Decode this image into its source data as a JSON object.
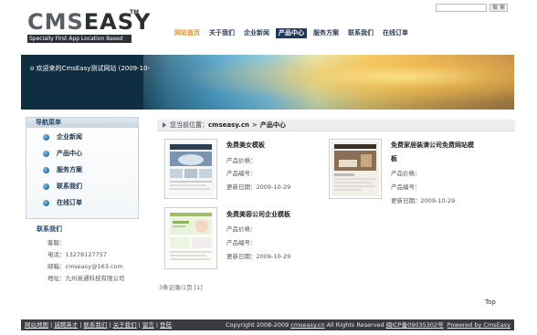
{
  "header": {
    "logo_main": "CMSEASY",
    "logo_tm": "TM",
    "logo_tag": "Specially First App Location Based",
    "search_button": "搜 索"
  },
  "nav": {
    "items": [
      "网站首页",
      "关于我们",
      "企业新闻",
      "产品中心",
      "服务方案",
      "联系我们",
      "在线订单"
    ],
    "active_index": 3
  },
  "banner": {
    "welcome": "o 欢迎来的CmsEasy测试网站 (2009-10-"
  },
  "sidebar": {
    "title": "导航菜单",
    "items": [
      "企业新闻",
      "产品中心",
      "服务方案",
      "联系我们",
      "在线订单"
    ],
    "contact_title": "联系我们",
    "contact_lines": [
      "客服：",
      "电话：13278127757",
      "邮箱：cmseasy@163.com",
      "地址：九州易通科技有限公司"
    ]
  },
  "breadcrumb": {
    "prefix": "您当前位置：",
    "site": "cmseasy.cn",
    "sep": ">",
    "current": "产品中心"
  },
  "products": [
    {
      "title": "免费美女模板",
      "price": "产品价格：",
      "code": "产品编号：",
      "date": "更新日期：2009-10-29"
    },
    {
      "title": "免费家居装潢公司免费网站模",
      "title2": "板",
      "price": "产品价格：",
      "code": "产品编号：",
      "date": "更新日期：2009-10-29"
    },
    {
      "title": "免费美容公司企业模板",
      "price": "产品价格：",
      "code": "产品编号：",
      "date": "更新日期：2009-10-29"
    }
  ],
  "pager": "3条记录/1页  [1]",
  "top_link": "Top",
  "footer": {
    "links": [
      "网站地图",
      "诚聘英才",
      "联系我们",
      "关于我们",
      "留言",
      "登陆"
    ],
    "copyright": "Copyright 2008-2009 ",
    "site_link": "cmseasy.cn",
    "rights": " All Rights Reserved ",
    "icp": "闽ICP备09035302号",
    "powered": "Powered by CmsEasy"
  },
  "colors": {
    "nav_active_bg": "#1b3a5c",
    "nav_home": "#e8942a",
    "footer_bg": "#3a3c40"
  }
}
